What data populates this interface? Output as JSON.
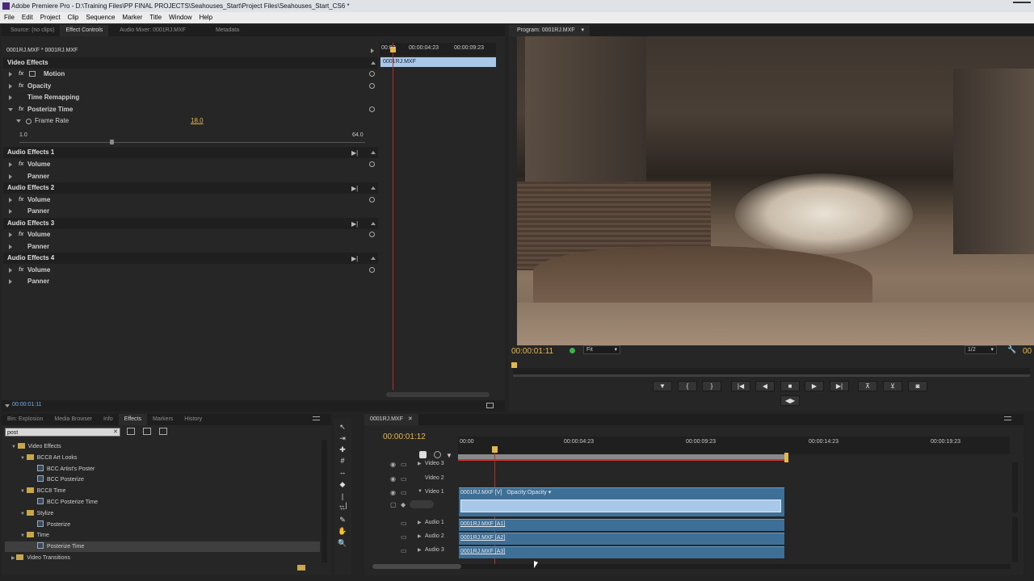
{
  "titlebar": {
    "title": "Adobe Premiere Pro - D:\\Training Files\\PP FINAL PROJECTS\\Seahouses_Start\\Project Files\\Seahouses_Start_CS6 *"
  },
  "menu": [
    "File",
    "Edit",
    "Project",
    "Clip",
    "Sequence",
    "Marker",
    "Title",
    "Window",
    "Help"
  ],
  "source_panel": {
    "tabs": [
      "Source: (no clips)",
      "Effect Controls",
      "Audio Mixer: 0001RJ.MXF",
      "Metadata"
    ],
    "active_tab": 1,
    "clip_header": "0001RJ.MXF * 0001RJ.MXF",
    "ruler_start": "00:00",
    "ruler_mid": "00:00:04:23",
    "ruler_end": "00:00:09:23",
    "mini_clip": "0001RJ.MXF",
    "video_effects_label": "Video Effects",
    "effects": [
      {
        "name": "Motion"
      },
      {
        "name": "Opacity"
      },
      {
        "name": "Time Remapping"
      },
      {
        "name": "Posterize Time"
      }
    ],
    "frame_rate_label": "Frame Rate",
    "frame_rate_value": "18.0",
    "slider_min": "1.0",
    "slider_max": "64.0",
    "audio_sections": [
      {
        "title": "Audio Effects 1",
        "items": [
          "Volume",
          "Panner"
        ]
      },
      {
        "title": "Audio Effects 2",
        "items": [
          "Volume",
          "Panner"
        ]
      },
      {
        "title": "Audio Effects 3",
        "items": [
          "Volume",
          "Panner"
        ]
      },
      {
        "title": "Audio Effects 4",
        "items": [
          "Volume",
          "Panner"
        ]
      }
    ],
    "bottom_timecode": "00:00:01:11"
  },
  "program": {
    "tab": "Program: 0001RJ.MXF",
    "timecode": "00:00:01:11",
    "fit": "Fit",
    "resolution": "1/2",
    "right_timecode": "00"
  },
  "project_panel": {
    "tabs": [
      "Bin: Explosion",
      "Media Browser",
      "Info",
      "Effects",
      "Markers",
      "History"
    ],
    "active_tab": 3,
    "search_value": "post",
    "tree": [
      {
        "level": 0,
        "type": "folder",
        "label": "Video Effects",
        "open": true
      },
      {
        "level": 1,
        "type": "folder",
        "label": "BCC8 Art Looks",
        "open": true
      },
      {
        "level": 2,
        "type": "preset",
        "label": "BCC Artist's Poster"
      },
      {
        "level": 2,
        "type": "preset",
        "label": "BCC Posterize"
      },
      {
        "level": 1,
        "type": "folder",
        "label": "BCC8 Time",
        "open": true
      },
      {
        "level": 2,
        "type": "preset",
        "label": "BCC Posterize Time"
      },
      {
        "level": 1,
        "type": "folder",
        "label": "Stylize",
        "open": true
      },
      {
        "level": 2,
        "type": "preset",
        "label": "Posterize"
      },
      {
        "level": 1,
        "type": "folder",
        "label": "Time",
        "open": true
      },
      {
        "level": 2,
        "type": "preset",
        "label": "Posterize Time",
        "selected": true
      },
      {
        "level": 0,
        "type": "folder",
        "label": "Video Transitions",
        "open": false
      }
    ]
  },
  "timeline": {
    "tab": "0001RJ.MXF",
    "timecode": "00:00:01:12",
    "ruler": [
      "00:00",
      "00:00:04:23",
      "00:00:09:23",
      "00:00:14:23",
      "00:00:19:23"
    ],
    "tracks": [
      {
        "label": "Video 3"
      },
      {
        "label": "Video 2"
      },
      {
        "label": "Video 1"
      },
      {
        "label": "Audio 1"
      },
      {
        "label": "Audio 2"
      },
      {
        "label": "Audio 3"
      }
    ],
    "video_clip": "0001RJ.MXF [V]",
    "video_clip_fx": "Opacity:Opacity",
    "audio_clips": [
      "0001RJ.MXF [A1]",
      "0001RJ.MXF [A2]",
      "0001RJ.MXF [A3]"
    ]
  },
  "colors": {
    "accent": "#e5b84d",
    "timecode_blue": "#6fb0e6",
    "playhead": "#d0342c",
    "clip_blue": "#3e6f96",
    "selection": "#a9c8e8"
  }
}
